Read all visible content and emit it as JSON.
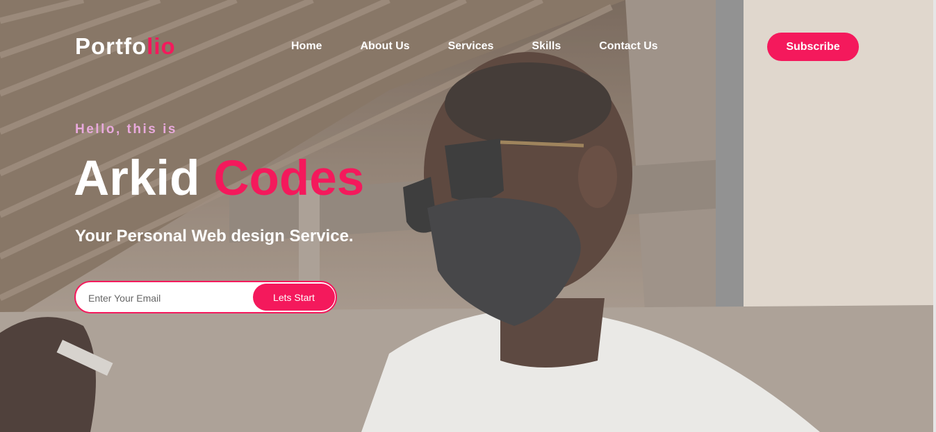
{
  "brand": {
    "logo_main": "Portfo",
    "logo_accent": "lio"
  },
  "nav": {
    "items": [
      "Home",
      "About Us",
      "Services",
      "Skills",
      "Contact Us"
    ]
  },
  "subscribe_label": "Subscribe",
  "hero": {
    "intro": "Hello, this is",
    "name_first": "Arkid ",
    "name_accent": "Codes",
    "tagline": "Your Personal Web design Service.",
    "email_placeholder": "Enter Your Email",
    "cta_label": "Lets Start"
  },
  "colors": {
    "accent": "#f4195c",
    "intro": "#e8a9dc",
    "text": "#ffffff"
  }
}
